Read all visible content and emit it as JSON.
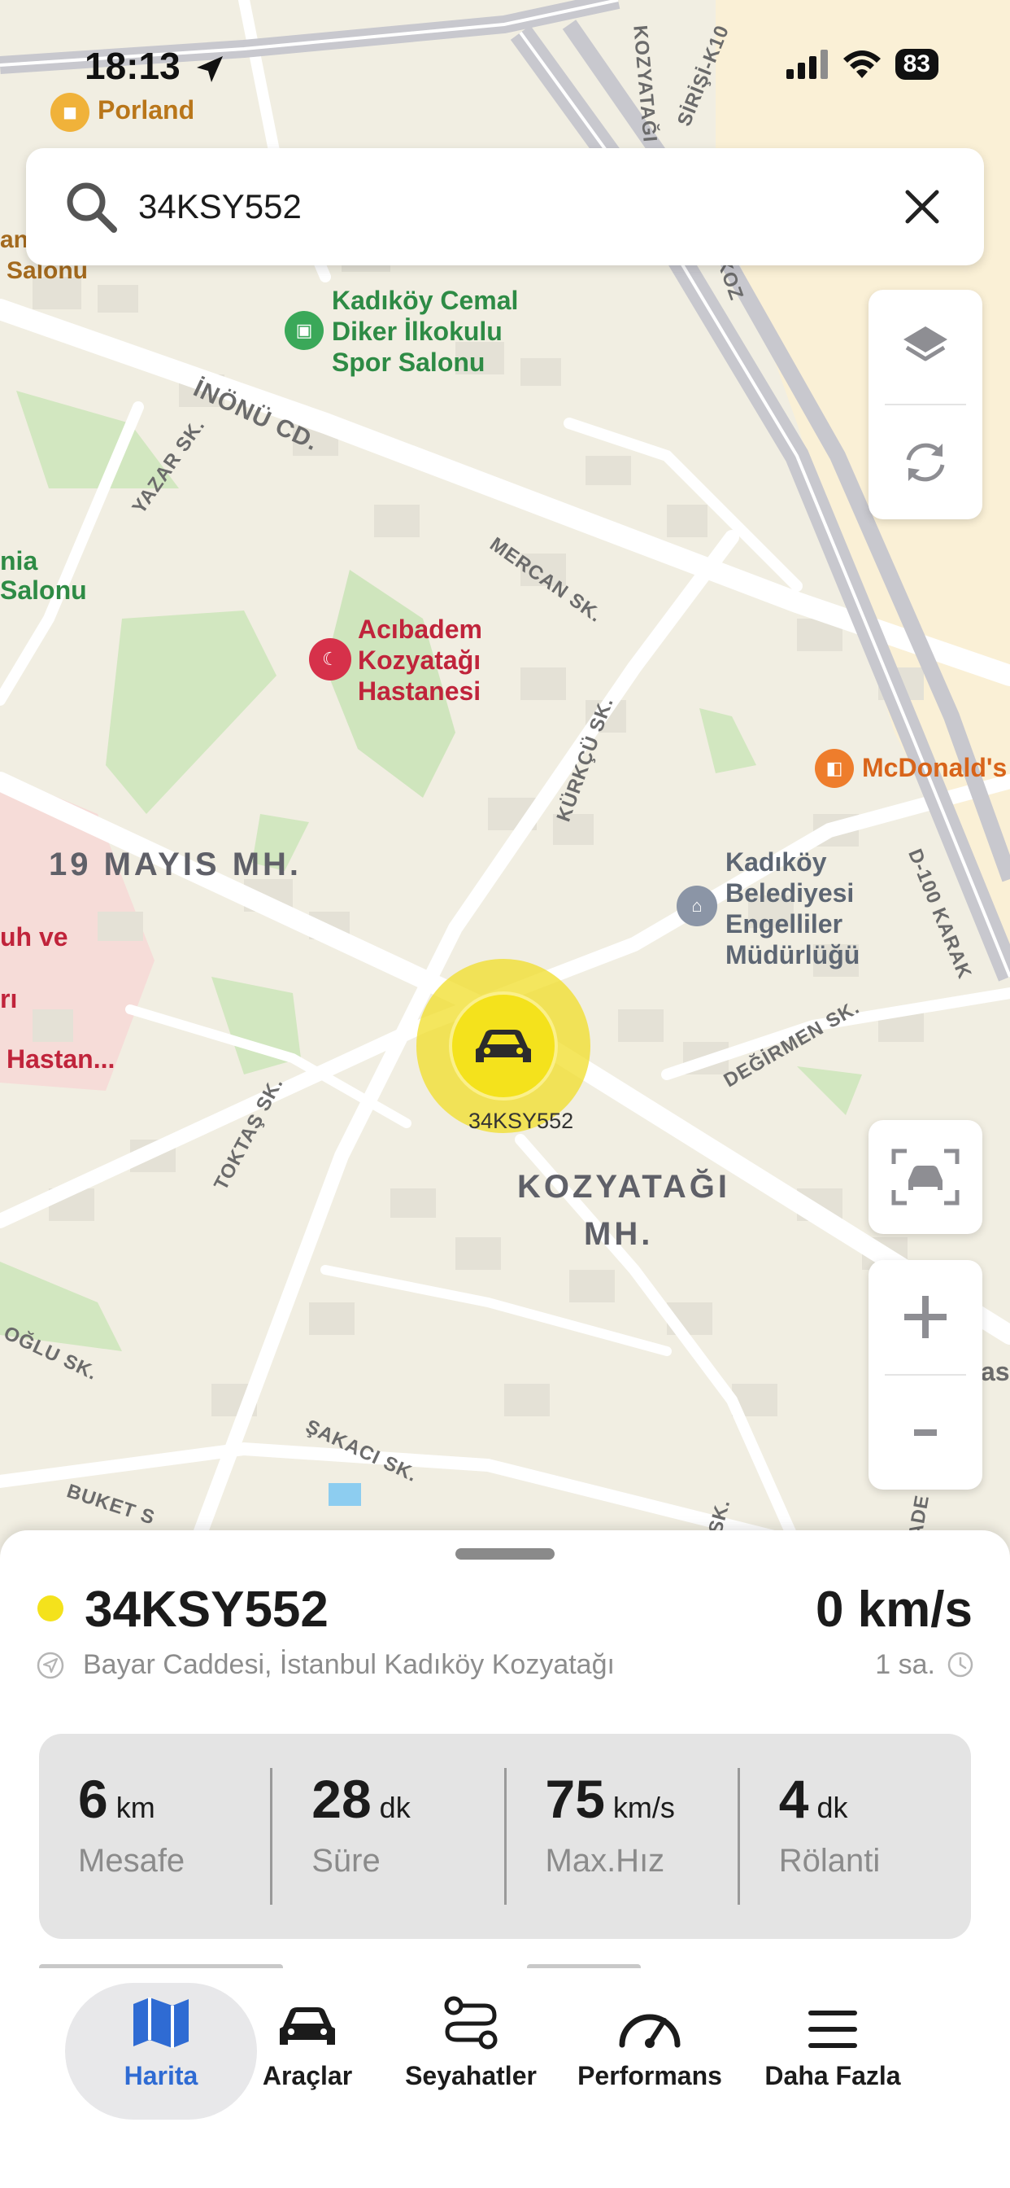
{
  "status_bar": {
    "time": "18:13",
    "battery": "83",
    "icons": [
      "location-arrow-icon",
      "signal-icon",
      "wifi-icon",
      "battery-icon"
    ]
  },
  "search": {
    "value": "34KSY552",
    "icons": [
      "search-icon",
      "close-icon"
    ]
  },
  "map": {
    "pois": {
      "porland": "Porland",
      "school_1": "Kadıköy Cemal",
      "school_2": "Diker İlkokulu",
      "school_3": "Spor Salonu",
      "hospital_1": "Acıbadem",
      "hospital_2": "Kozyatağı",
      "hospital_3": "Hastanesi",
      "mcdonalds": "McDonald's",
      "municipal_1": "Kadıköy",
      "municipal_2": "Belediyesi",
      "municipal_3": "Engelliler",
      "municipal_4": "Müdürlüğü",
      "salonu_top": "Salonu",
      "salonu_left_1": "nia",
      "salonu_left_2": "Salonu",
      "left_1": "uh ve",
      "left_2": "rı",
      "left_3": "Hastan...",
      "edge_left": "anl",
      "edge_right": "as"
    },
    "districts": {
      "mayis": "19 MAYIS MH.",
      "kozyatagi_1": "KOZYATAĞI",
      "kozyatagi_2": "MH."
    },
    "streets": {
      "inonu": "İNÖNÜ CD.",
      "yazar": "YAZAR SK.",
      "mercan": "MERCAN SK.",
      "kurkcu": "KÜRKÇÜ SK.",
      "toktas": "TOKTAŞ SK.",
      "degirmen": "DEĞİRMEN SK.",
      "sakaci": "ŞAKACI SK.",
      "buket": "BUKET S",
      "oglu": "OĞLU SK.",
      "d100": "D-100 KARAK",
      "kozyatagi_k10": "SİRİŞİ-K10",
      "kozy": "KOZYATAĞI",
      "koz": "KOZ",
      "sk": "SK.",
      "ade": "ADE"
    },
    "vehicle_marker_label": "34KSY552",
    "controls": [
      "layers-icon",
      "refresh-icon",
      "focus-vehicle-icon",
      "zoom-in-icon",
      "zoom-out-icon"
    ]
  },
  "vehicle": {
    "plate": "34KSY552",
    "speed": "0 km/s",
    "address": "Bayar Caddesi, İstanbul Kadıköy Kozyatağı",
    "last_update": "1 sa.",
    "status_color": "#f4e21c"
  },
  "stats": [
    {
      "value": "6",
      "unit": "km",
      "label": "Mesafe"
    },
    {
      "value": "28",
      "unit": "dk",
      "label": "Süre"
    },
    {
      "value": "75",
      "unit": "km/s",
      "label": "Max.Hız"
    },
    {
      "value": "4",
      "unit": "dk",
      "label": "Rölanti"
    }
  ],
  "tabs": [
    {
      "label": "Harita",
      "icon": "map-icon",
      "active": true
    },
    {
      "label": "Araçlar",
      "icon": "car-icon",
      "active": false
    },
    {
      "label": "Seyahatler",
      "icon": "route-icon",
      "active": false
    },
    {
      "label": "Performans",
      "icon": "gauge-icon",
      "active": false
    },
    {
      "label": "Daha Fazla",
      "icon": "menu-icon",
      "active": false
    }
  ],
  "colors": {
    "accent": "#2f6bd3",
    "vehicle_yellow": "#f4e21c",
    "map_background": "#f1eee2"
  }
}
